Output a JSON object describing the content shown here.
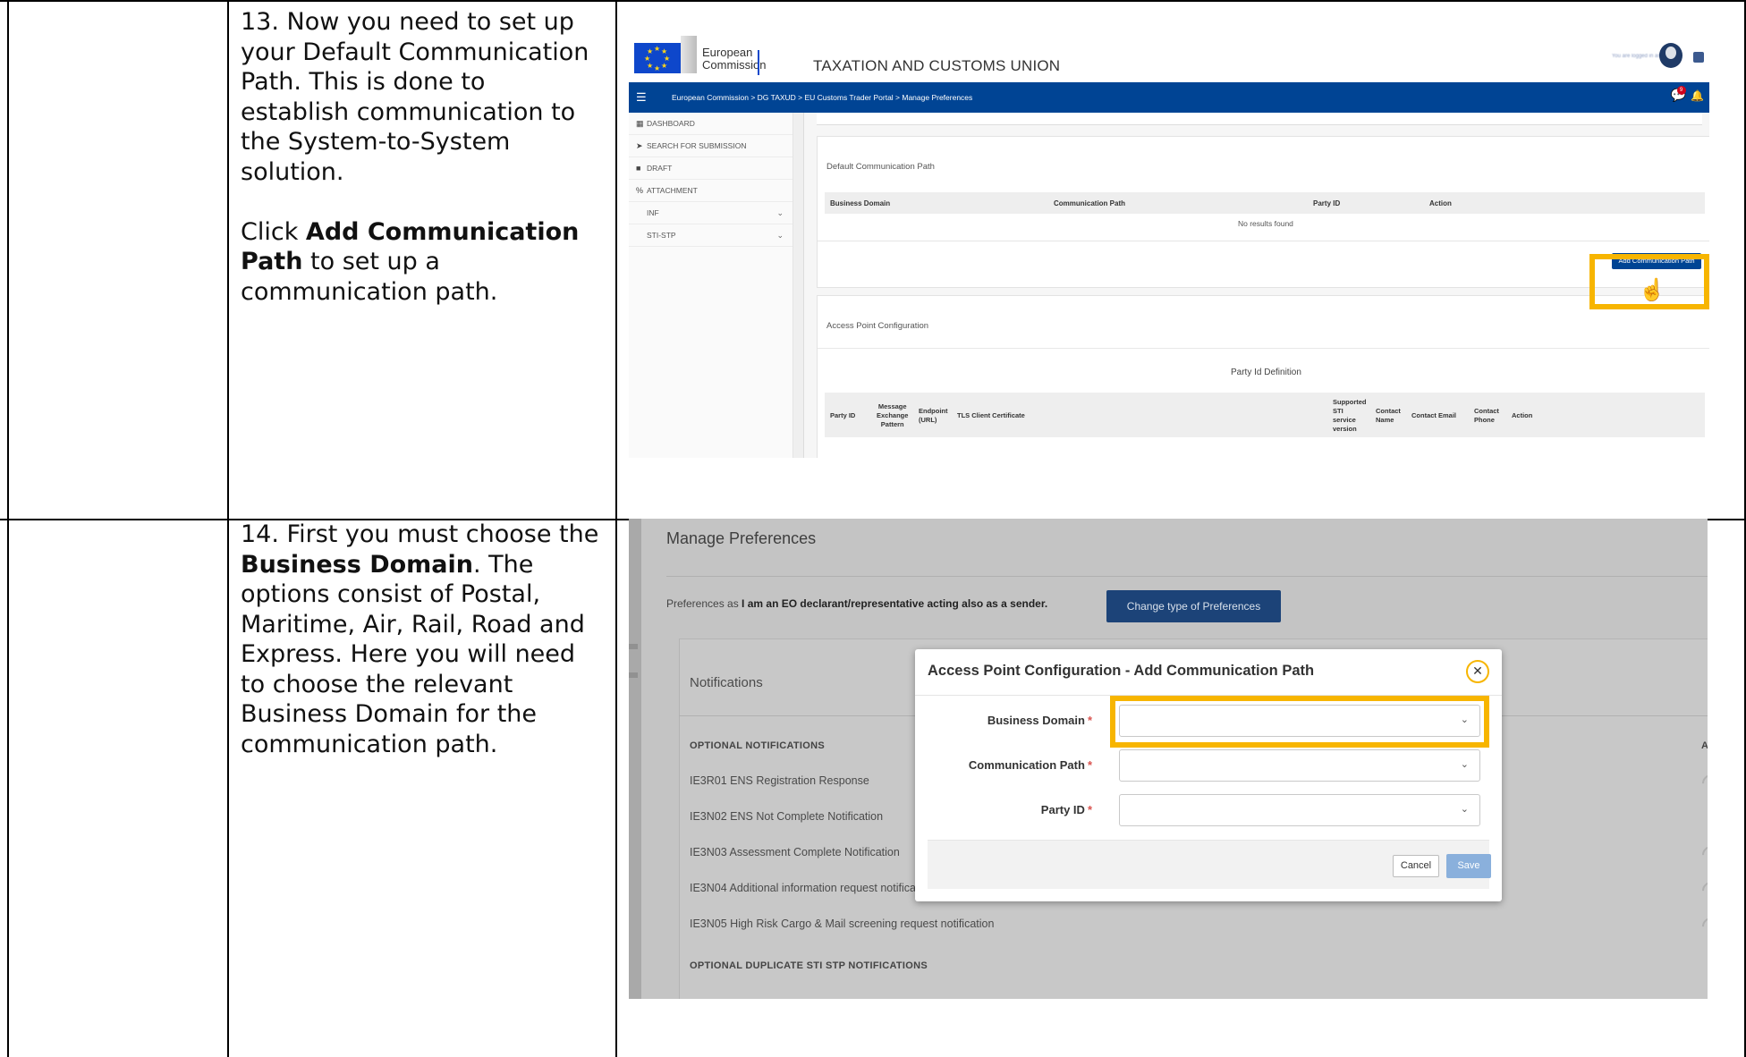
{
  "steps": [
    {
      "lines": [
        "13. Now you need to set up",
        "your Default Communication",
        "Path. This is done to",
        "establish communication to",
        "the System-to-System",
        "solution."
      ],
      "click_prefix": "Click ",
      "click_bold_1": "Add Communication",
      "click_bold_2": "Path",
      "click_suffix_1": " to set up a",
      "click_suffix_2": "communication path."
    },
    {
      "line1": "14. First you must choose the",
      "bold": "Business Domain",
      "line2_rest": ". The",
      "lines": [
        "options consist of Postal,",
        "Maritime, Air, Rail, Road and",
        "Express. Here you will need",
        "to choose the relevant",
        "Business Domain for the",
        "communication path."
      ]
    }
  ],
  "screenshot1": {
    "logo_line1": "European",
    "logo_line2": "Commission",
    "site_title": "TAXATION AND CUSTOMS UNION",
    "user_text": "You are logged in as ...",
    "breadcrumb": "European Commission  >  DG TAXUD  >  EU Customs Trader Portal  >  Manage Preferences",
    "sidebar": [
      {
        "icon": "dashboard-icon",
        "glyph": "▦",
        "label": "DASHBOARD",
        "chevron": false
      },
      {
        "icon": "send-icon",
        "glyph": "➤",
        "label": "SEARCH FOR SUBMISSION",
        "chevron": false
      },
      {
        "icon": "file-icon",
        "glyph": "■",
        "label": "DRAFT",
        "chevron": false
      },
      {
        "icon": "paperclip-icon",
        "glyph": "%",
        "label": "ATTACHMENT",
        "chevron": false
      },
      {
        "icon": "",
        "glyph": "",
        "label": "INF",
        "chevron": true
      },
      {
        "icon": "",
        "glyph": "",
        "label": "STI-STP",
        "chevron": true
      }
    ],
    "default_path": {
      "title": "Default Communication Path",
      "columns": [
        "Business Domain",
        "Communication Path",
        "Party ID",
        "Action"
      ],
      "empty": "No results found",
      "button": "Add Communication Path"
    },
    "access_point": {
      "title": "Access Point Configuration",
      "subtitle": "Party Id Definition",
      "columns": {
        "party_id": "Party ID",
        "mep_1": "Message",
        "mep_2": "Exchange",
        "mep_3": "Pattern",
        "endpoint_1": "Endpoint",
        "endpoint_2": "(URL)",
        "tls": "TLS Client Certificate",
        "sti_1": "Supported",
        "sti_2": "STI",
        "sti_3": "service",
        "sti_4": "version",
        "cname_1": "Contact",
        "cname_2": "Name",
        "cemail": "Contact Email",
        "cphone_1": "Contact",
        "cphone_2": "Phone",
        "action": "Action"
      }
    }
  },
  "screenshot2": {
    "page_title": "Manage Preferences",
    "pref_prefix": "Preferences as ",
    "pref_value": "I am an EO declarant/representative acting also as a sender.",
    "change_button": "Change type of Preferences",
    "notifications_title": "Notifications",
    "optional_header": "OPTIONAL NOTIFICATIONS",
    "as_label": "AS",
    "rows": [
      "IE3R01 ENS Registration Response",
      "IE3N02 ENS Not Complete Notification",
      "IE3N03 Assessment Complete Notification",
      "IE3N04 Additional information request notifica",
      "IE3N05 High Risk Cargo & Mail screening request notification"
    ],
    "duplicate_header": "OPTIONAL DUPLICATE STI STP NOTIFICATIONS",
    "modal": {
      "title": "Access Point Configuration - Add Communication Path",
      "close_glyph": "✕",
      "fields": [
        {
          "label": "Business Domain",
          "required": "*"
        },
        {
          "label": "Communication Path",
          "required": "*"
        },
        {
          "label": "Party ID",
          "required": "*"
        }
      ],
      "chevron": "⌄",
      "cancel": "Cancel",
      "save": "Save"
    }
  },
  "colors": {
    "ec_blue": "#004494",
    "highlight": "#f7b500",
    "modal_save": "#8ab0dc",
    "change_btn": "#1c4378"
  }
}
